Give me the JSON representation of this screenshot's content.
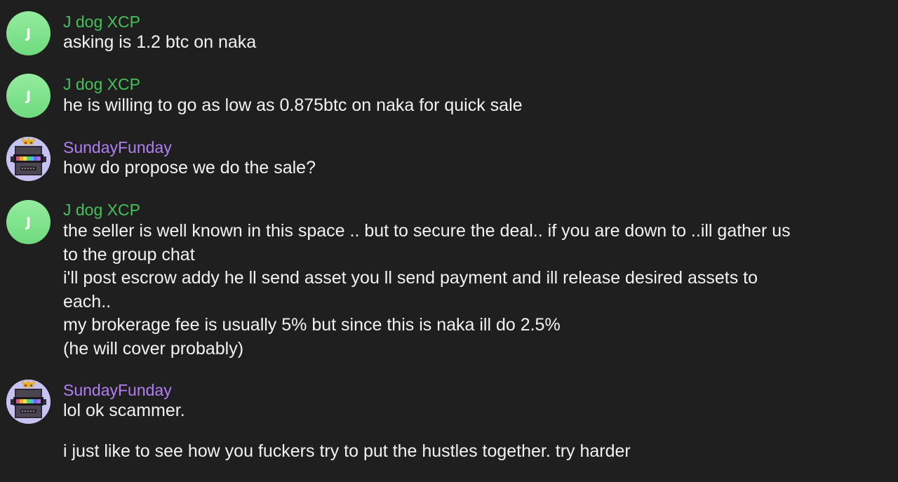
{
  "colors": {
    "background": "#1f1f1f",
    "text": "#f2f2f2",
    "jdog_name": "#45c159",
    "sunday_name": "#b27ef3",
    "jdog_avatar": "#7fe08c",
    "sunday_avatar_bg": "#c6c2f2"
  },
  "messages": [
    {
      "author": "J dog XCP",
      "avatar_letter": "J",
      "lines": [
        "asking is 1.2 btc on naka"
      ]
    },
    {
      "author": "J dog XCP",
      "avatar_letter": "J",
      "lines": [
        "he is willing to go as low as 0.875btc on naka for quick sale"
      ]
    },
    {
      "author": "SundayFunday",
      "avatar_icon": "pixel-robot-king-icon",
      "lines": [
        "how do propose we do the sale?"
      ]
    },
    {
      "author": "J dog XCP",
      "avatar_letter": "J",
      "lines": [
        "the seller is well known in this space .. but to secure the deal.. if you are down to ..ill gather us",
        "to the group chat",
        "i'll post escrow addy he ll send asset you ll send payment and ill release desired assets to",
        "each..",
        "my brokerage fee is usually 5% but since this is naka ill do 2.5%",
        "(he will cover probably)"
      ]
    },
    {
      "author": "SundayFunday",
      "avatar_icon": "pixel-robot-king-icon",
      "lines": [
        "lol ok scammer.",
        "i just like to see how you fuckers try to put the hustles together. try harder"
      ]
    }
  ]
}
